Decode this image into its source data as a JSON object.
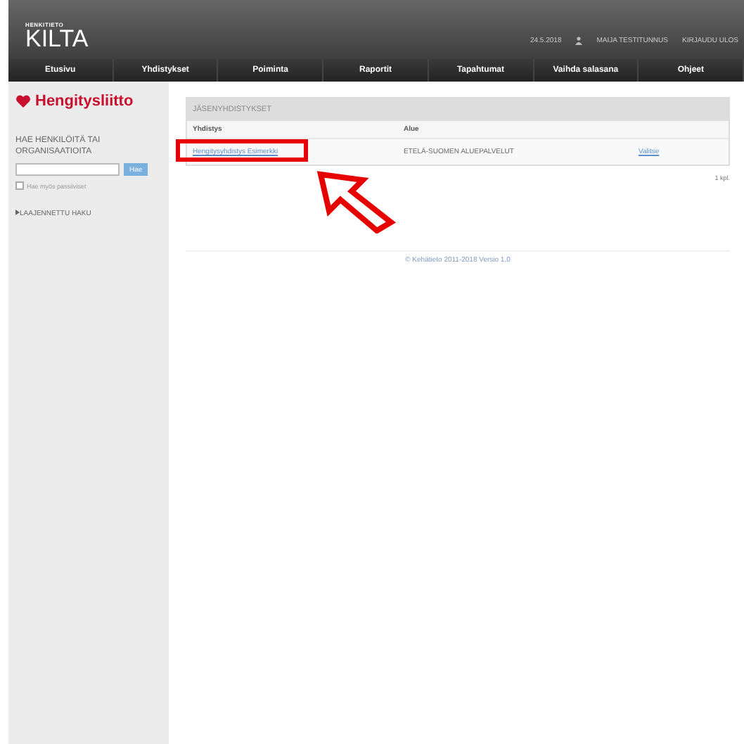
{
  "header": {
    "logo_small": "HENKITIETO",
    "logo": "KILTA",
    "date": "24.5.2018",
    "user": "MAIJA TESTITUNNUS",
    "logout": "KIRJAUDU ULOS"
  },
  "nav": [
    {
      "label": "Etusivu"
    },
    {
      "label": "Yhdistykset"
    },
    {
      "label": "Poiminta"
    },
    {
      "label": "Raportit"
    },
    {
      "label": "Tapahtumat"
    },
    {
      "label": "Vaihda salasana"
    },
    {
      "label": "Ohjeet"
    }
  ],
  "sidebar": {
    "brand": "Hengitysliitto",
    "search_title": "HAE HENKILÖITÄ TAI ORGANISAATIOITA",
    "search_button": "Hae",
    "passive_option": {
      "label": "Hae myös passiiviset",
      "checked": false
    },
    "advanced": "LAAJENNETTU HAKU"
  },
  "panel": {
    "title": "JÄSENYHDISTYKSET",
    "columns": [
      "Yhdistys",
      "Alue"
    ],
    "rows": [
      {
        "name": "Hengitysyhdistys Esimerkki",
        "area": "ETELÄ-SUOMEN ALUEPALVELUT",
        "action": "Valitse",
        "highlighted": true
      }
    ],
    "count": "1 kpl."
  },
  "footer": {
    "copyright": "© Kehätieto 2011-2018",
    "version": "Versio 1.0"
  }
}
